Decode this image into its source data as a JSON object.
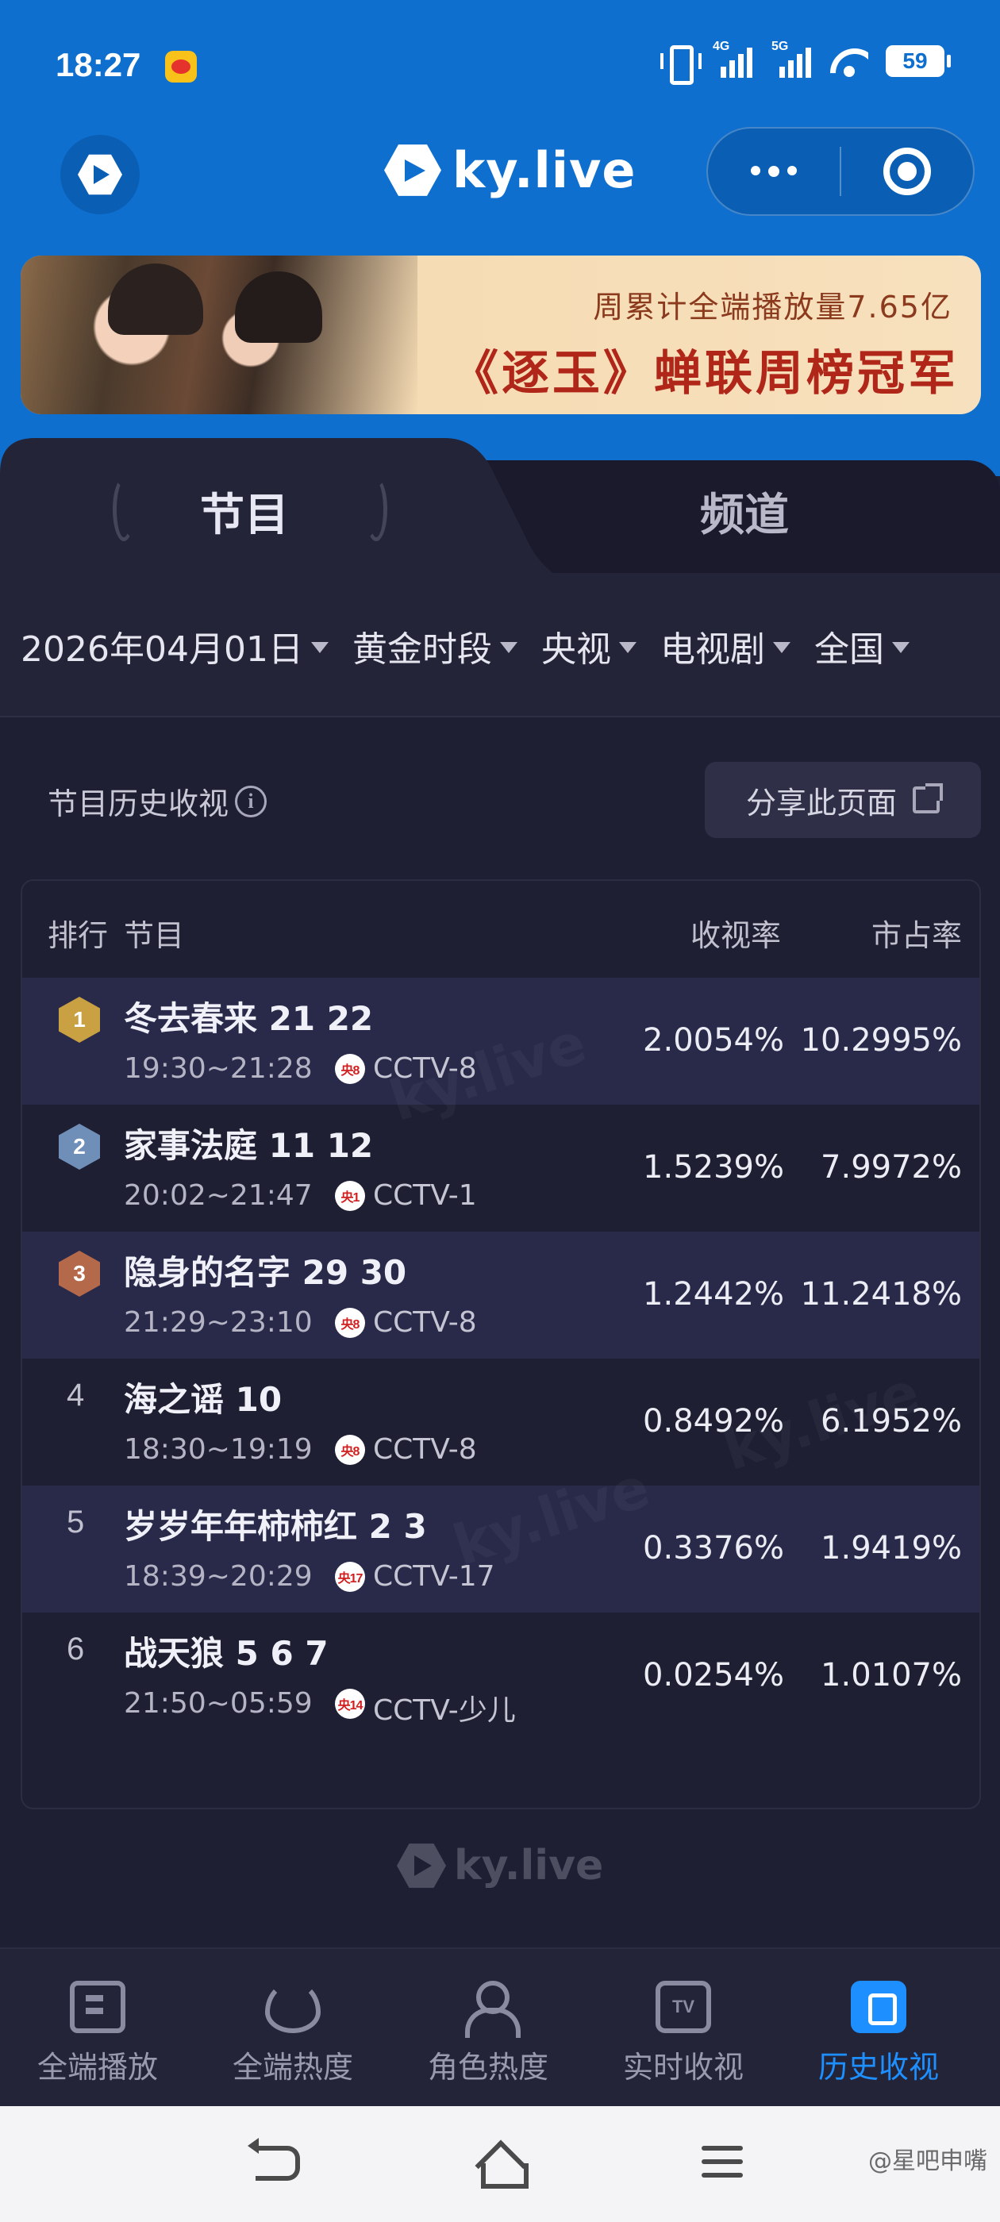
{
  "status_bar": {
    "time": "18:27",
    "signal1_label": "4G",
    "signal2_label": "5G",
    "battery": "59"
  },
  "header": {
    "brand": "ky.live"
  },
  "banner": {
    "line1": "周累计全端播放量7.65亿",
    "line2": "《逐玉》蝉联周榜冠军"
  },
  "tabs": [
    {
      "label": "节目",
      "active": true
    },
    {
      "label": "频道",
      "active": false
    }
  ],
  "filters": [
    "2026年04月01日",
    "黄金时段",
    "央视",
    "电视剧",
    "全国"
  ],
  "section": {
    "title": "节目历史收视",
    "share_button": "分享此页面"
  },
  "table": {
    "headers": {
      "rank": "排行",
      "program": "节目",
      "rating": "收视率",
      "share": "市占率"
    },
    "rows": [
      {
        "rank": "1",
        "name": "冬去春来 21 22",
        "time": "19:30~21:28",
        "channel_icon": "央8",
        "channel": "CCTV-8",
        "rating": "2.0054%",
        "share": "10.2995%"
      },
      {
        "rank": "2",
        "name": "家事法庭 11 12",
        "time": "20:02~21:47",
        "channel_icon": "央1",
        "channel": "CCTV-1",
        "rating": "1.5239%",
        "share": "7.9972%"
      },
      {
        "rank": "3",
        "name": "隐身的名字 29 30",
        "time": "21:29~23:10",
        "channel_icon": "央8",
        "channel": "CCTV-8",
        "rating": "1.2442%",
        "share": "11.2418%"
      },
      {
        "rank": "4",
        "name": "海之谣 10",
        "time": "18:30~19:19",
        "channel_icon": "央8",
        "channel": "CCTV-8",
        "rating": "0.8492%",
        "share": "6.1952%"
      },
      {
        "rank": "5",
        "name": "岁岁年年柿柿红 2 3",
        "time": "18:39~20:29",
        "channel_icon": "央17",
        "channel": "CCTV-17",
        "rating": "0.3376%",
        "share": "1.9419%"
      },
      {
        "rank": "6",
        "name": "战天狼 5 6 7",
        "time": "21:50~05:59",
        "channel_icon": "央14",
        "channel": "CCTV-少儿",
        "rating": "0.0254%",
        "share": "1.0107%"
      }
    ],
    "rank_colors": {
      "1": "#c9a042",
      "2": "#6f8fb8",
      "3": "#b46a4a"
    }
  },
  "footer_logo": "ky.live",
  "bottom_tabs": [
    {
      "label": "全端播放",
      "icon": "play-rank-icon",
      "active": false
    },
    {
      "label": "全端热度",
      "icon": "fire-icon",
      "active": false
    },
    {
      "label": "角色热度",
      "icon": "user-icon",
      "active": false
    },
    {
      "label": "实时收视",
      "icon": "tv-icon",
      "active": false
    },
    {
      "label": "历史收视",
      "icon": "history-icon",
      "active": true
    }
  ],
  "tv_icon_text": "TV",
  "watermark_text": "@星吧申嘴",
  "accent_color": "#1e8fff",
  "header_color": "#0e6fcf"
}
